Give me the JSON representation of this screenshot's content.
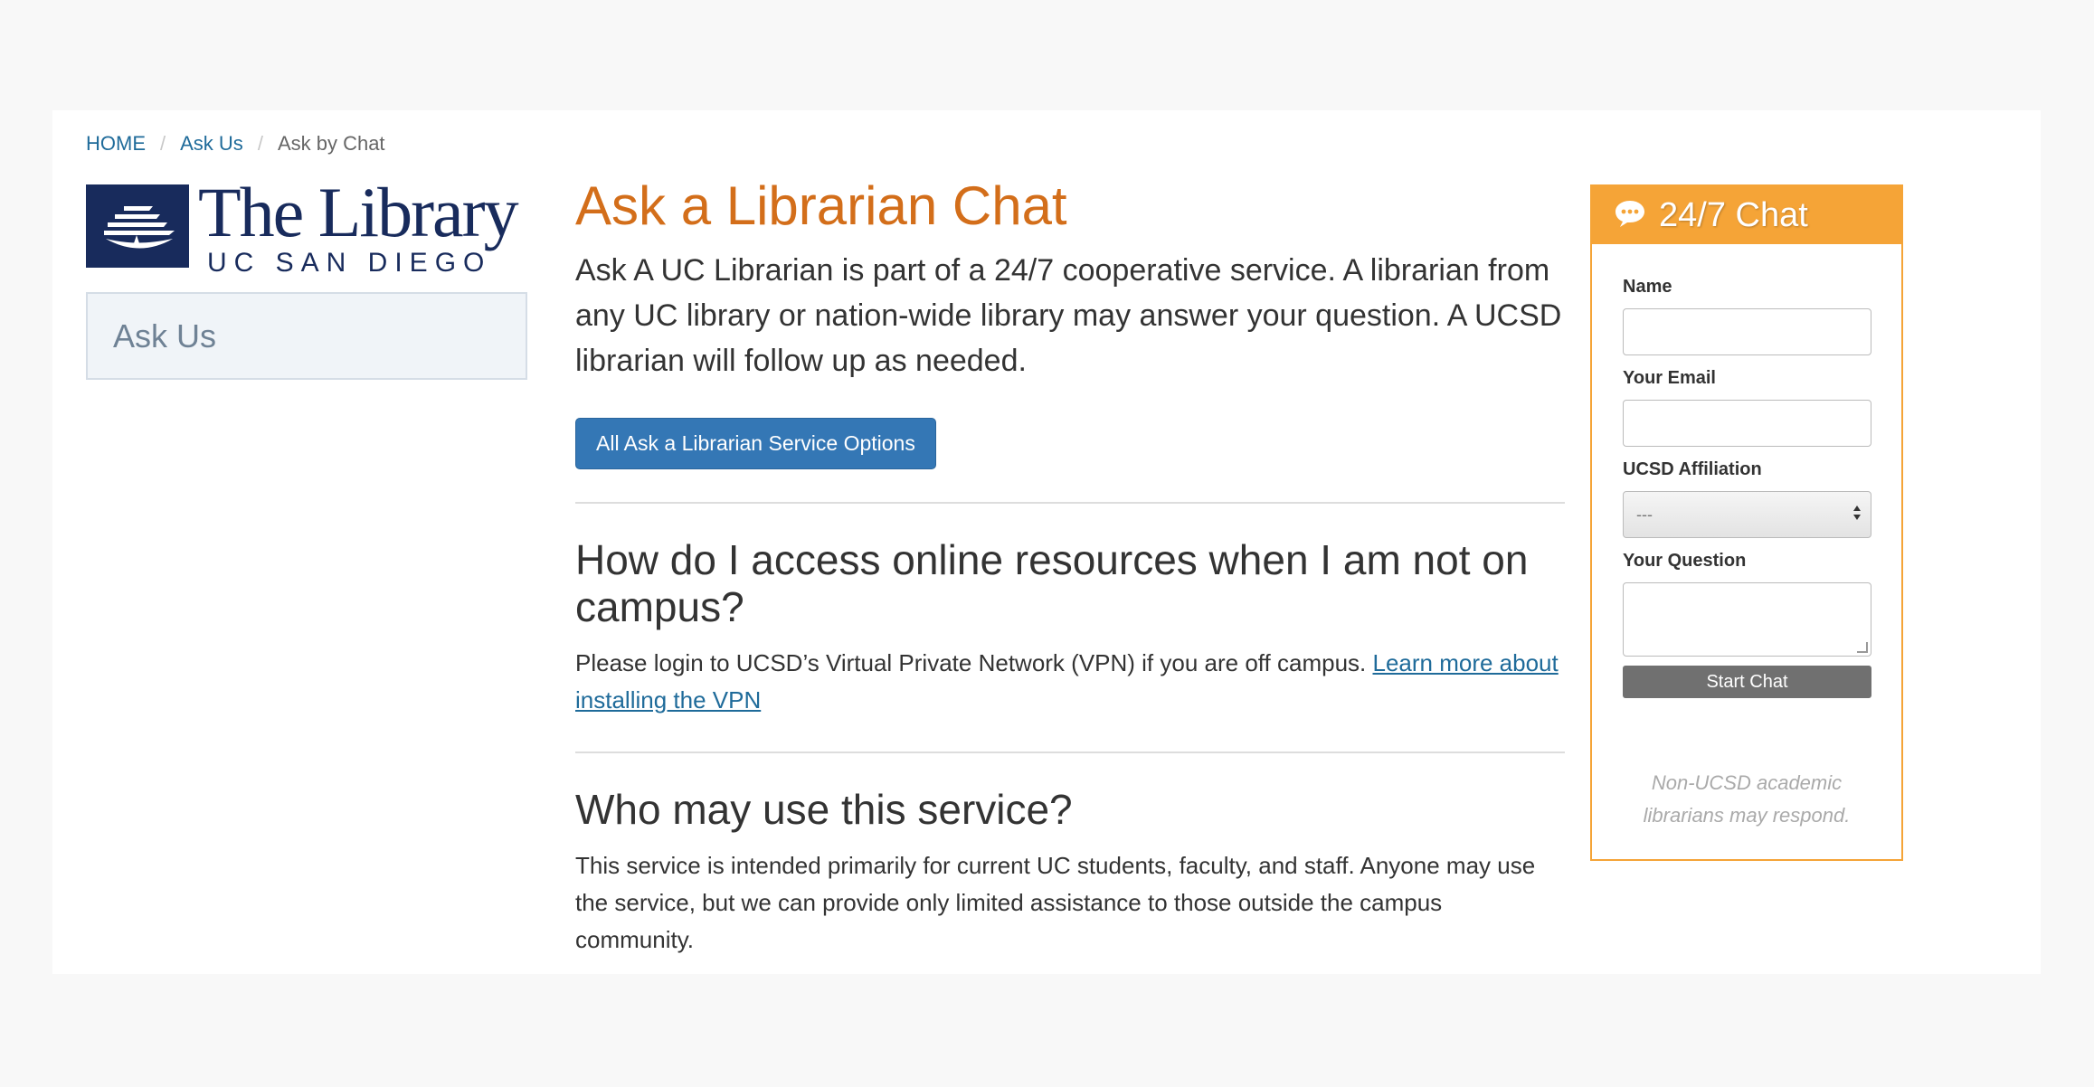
{
  "breadcrumb": {
    "home": "HOME",
    "ask_us": "Ask Us",
    "current": "Ask by Chat",
    "separator": "/"
  },
  "logo": {
    "title": "The Library",
    "subtitle": "UC SAN DIEGO"
  },
  "sidebar": {
    "items": [
      {
        "label": "Ask Us"
      }
    ]
  },
  "main": {
    "title": "Ask a Librarian Chat",
    "lead": "Ask A UC Librarian is part of a 24/7 cooperative service. A librarian from any UC library or nation-wide library may answer your question. A UCSD librarian will follow up as needed.",
    "service_button": "All Ask a Librarian Service Options",
    "faq": [
      {
        "question": "How do I access online resources when I am not on campus?",
        "answer": "Please login to UCSD’s Virtual Private Network (VPN) if you are off campus. ",
        "link": "Learn more about installing the VPN"
      },
      {
        "question": "Who may use this service?",
        "answer": "This service is intended primarily for current UC students, faculty, and staff. Anyone may use the service, but we can provide only limited assistance to those outside the campus community."
      }
    ]
  },
  "chat": {
    "title": "24/7 Chat",
    "name_label": "Name",
    "email_label": "Your Email",
    "affiliation_label": "UCSD Affiliation",
    "affiliation_value": "---",
    "question_label": "Your Question",
    "start_button": "Start Chat",
    "note": "Non-UCSD academic librarians may respond.",
    "accent_color": "#f5a437"
  },
  "colors": {
    "title": "#d36e1a",
    "link": "#1f6b9a",
    "button": "#3477b5",
    "logo": "#182b5c"
  },
  "icons": {
    "chat": "chat-bubble-icon",
    "select": "updown-arrows-icon",
    "logo": "ship-emblem-icon"
  }
}
